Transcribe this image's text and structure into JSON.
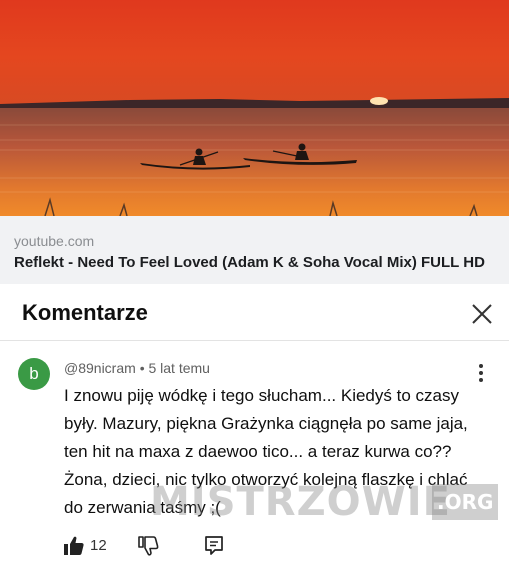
{
  "link_preview": {
    "domain": "youtube.com",
    "title": "Reflekt - Need To Feel Loved (Adam K & Soha Vocal Mix) FULL HD",
    "thumbnail": "sunset-lake-kayaks"
  },
  "comments_panel": {
    "title": "Komentarze",
    "close_icon": "close-icon"
  },
  "comment": {
    "avatar_letter": "b",
    "avatar_color": "#3a9a45",
    "author": "@89nicram",
    "separator": "•",
    "time": "5 lat temu",
    "text": "I znowu piję wódkę i tego słucham... Kiedyś to czasy były. Mazury, piękna Grażynka ciągnęła po same jaja, ten hit na maxa z daewoo tico... a teraz kurwa co?? Żona, dzieci, nic tylko otworzyć kolejną flaszkę i chlać do zerwania taśmy ;(",
    "likes": "12",
    "icons": [
      "thumbs-up-icon",
      "thumbs-down-icon",
      "reply-icon",
      "kebab-menu-icon"
    ]
  },
  "watermark": {
    "text": "MISTRZOWIE",
    "suffix": ".ORG"
  }
}
